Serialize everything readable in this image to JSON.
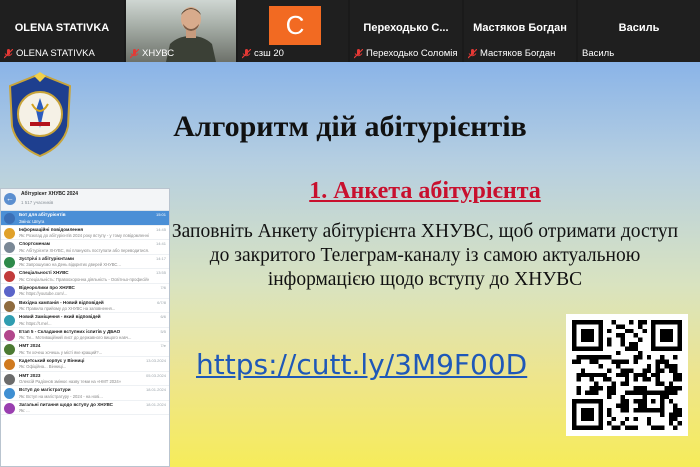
{
  "participants": [
    {
      "display_name": "OLENA STATIVKA",
      "label": "OLENA STATIVKA"
    },
    {
      "display_name": "",
      "label": "ХНУВС"
    },
    {
      "display_name": "",
      "label": "сзш 20",
      "avatar_letter": "С"
    },
    {
      "display_name": "Переходько С...",
      "label": "Переходько Соломія"
    },
    {
      "display_name": "Мастяков Богдан",
      "label": "Мастяков Богдан"
    },
    {
      "display_name": "Василь",
      "label": "Василь"
    }
  ],
  "slide": {
    "title": "Алгоритм дій абітурієнтів",
    "step_title": "1. Анкета абітурієнта",
    "description": "Заповніть Анкету абітурієнта ХНУВС, щоб отримати доступ до закритого Телеграм-каналу із самою актуальною інформацією щодо вступу до ХНУВС",
    "link": "https://cutt.ly/3M9F00D"
  },
  "telegram": {
    "title": "Абітурієнт ХНУВС 2024",
    "subtitle": "1 517 учасників",
    "chats": [
      {
        "name": "Бот для абітурієнтів",
        "msg": "Зміна: Шпуга",
        "time": "15:01"
      },
      {
        "name": "Інформаційні повідомлення",
        "msg": "Як: Розклад до абітурієнтів 2024 року вступу - у тому повідомленні \"Т...",
        "time": "14:45"
      },
      {
        "name": "Спортсменам",
        "msg": "Як: Абітурієнти ХНУВС, які планують поступати або переводитися...",
        "time": "14:41"
      },
      {
        "name": "Зустрічі з абітурієнтами",
        "msg": "Як: Запрошуємо на День відкритих дверей ХНУВС...",
        "time": "14:17"
      },
      {
        "name": "Спеціальності ХНУВС",
        "msg": "Як: Спеціальність: Правоохоронна діяльність - Освітньо-професійна про...",
        "time": "13:55"
      },
      {
        "name": "Відеоролики про ХНУВС",
        "msg": "Як: https://youtube.com/...",
        "time": "7/6"
      },
      {
        "name": "Вихідна кампанія - Новий відповідей",
        "msg": "Як: Правила прийому до ХНУВС на заповнення...",
        "time": "6/7/8"
      },
      {
        "name": "Новий Заміщення - який відповідей",
        "msg": "Як: https://t.me/...",
        "time": "6/6"
      },
      {
        "name": "Етап 5 - Складання вступних іспитів у ДБАО",
        "msg": "Як: Ти... Мотиваційний лист до державного вищого навч...",
        "time": "5/5"
      },
      {
        "name": "НМТ 2024",
        "msg": "Як: Ти хочеш хочешь у місті яке кращий?...",
        "time": "7/e"
      },
      {
        "name": "Кадетський корпус у Вінниці",
        "msg": "Як: Офіційна... Вінниці...",
        "time": "13.03.2024"
      },
      {
        "name": "НМТ 2023",
        "msg": "Олексій Радіонов змінює назву теми на «НМТ 2024»",
        "time": "05.03.2024"
      },
      {
        "name": "Вступ до магістратури",
        "msg": "Як: Вступ на магістратуру - 2024 - на нові...",
        "time": "18.01.2024"
      },
      {
        "name": "Загальні питання щодо вступу до ХНУВС",
        "msg": "Як: ...",
        "time": "18.01.2024"
      }
    ]
  },
  "colors": {
    "accent_step": "#c8102e",
    "link": "#1f58b8",
    "avatar_c": "#f26a22",
    "telegram_selected": "#4b8fd6"
  }
}
